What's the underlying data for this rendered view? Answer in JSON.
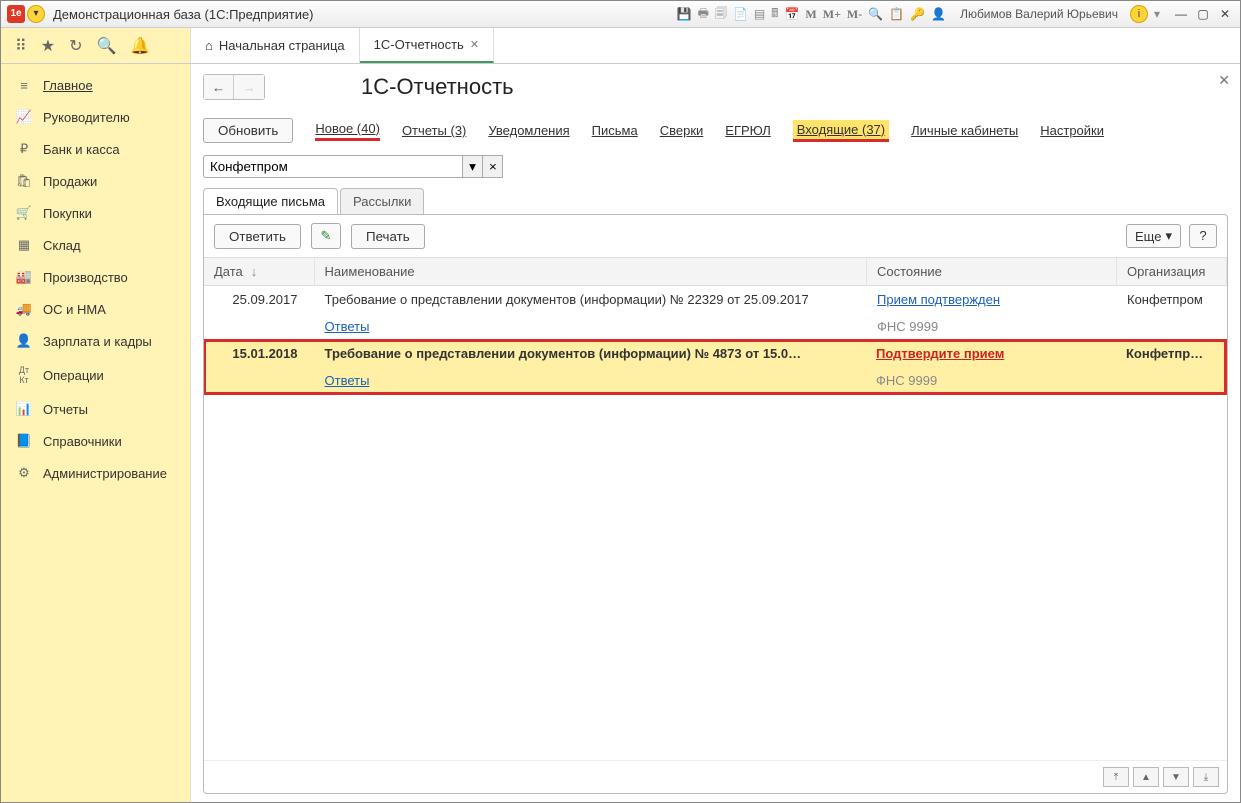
{
  "titlebar": {
    "title": "Демонстрационная база  (1С:Предприятие)",
    "user": "Любимов Валерий Юрьевич"
  },
  "tabs": {
    "home": "Начальная страница",
    "reporting": "1С-Отчетность"
  },
  "sidebar": {
    "items": [
      {
        "icon": "★",
        "label": "Главное"
      },
      {
        "icon": "📈",
        "label": "Руководителю"
      },
      {
        "icon": "₽",
        "label": "Банк и касса"
      },
      {
        "icon": "🛍",
        "label": "Продажи"
      },
      {
        "icon": "🛒",
        "label": "Покупки"
      },
      {
        "icon": "▦",
        "label": "Склад"
      },
      {
        "icon": "🏭",
        "label": "Производство"
      },
      {
        "icon": "🚚",
        "label": "ОС и НМА"
      },
      {
        "icon": "👤",
        "label": "Зарплата и кадры"
      },
      {
        "icon": "Дт",
        "label": "Операции"
      },
      {
        "icon": "📊",
        "label": "Отчеты"
      },
      {
        "icon": "📘",
        "label": "Справочники"
      },
      {
        "icon": "⚙",
        "label": "Администрирование"
      }
    ]
  },
  "page": {
    "title": "1С-Отчетность",
    "refresh": "Обновить",
    "links": {
      "new": "Новое (40)",
      "reports": "Отчеты (3)",
      "notifications": "Уведомления",
      "letters": "Письма",
      "recon": "Сверки",
      "egrul": "ЕГРЮЛ",
      "incoming": "Входящие (37)",
      "cabinets": "Личные кабинеты",
      "settings": "Настройки"
    },
    "filter_value": "Конфетпром",
    "inner_tabs": {
      "inbox": "Входящие письма",
      "mailings": "Рассылки"
    },
    "actions": {
      "reply": "Ответить",
      "print": "Печать",
      "more": "Еще",
      "help": "?"
    },
    "columns": {
      "date": "Дата",
      "name": "Наименование",
      "state": "Состояние",
      "org": "Организация"
    },
    "rows": [
      {
        "date": "25.09.2017",
        "name": "Требование о представлении документов (информации) № 22329 от 25.09.2017",
        "answers": "Ответы",
        "state": "Прием подтвержден",
        "state_sub": "ФНС 9999",
        "org": "Конфетпром",
        "state_style": "blue"
      },
      {
        "date": "15.01.2018",
        "name": "Требование о представлении документов (информации) № 4873 от 15.0…",
        "answers": "Ответы",
        "state": "Подтвердите прием",
        "state_sub": "ФНС 9999",
        "org": "Конфетпр…",
        "state_style": "red"
      }
    ]
  }
}
